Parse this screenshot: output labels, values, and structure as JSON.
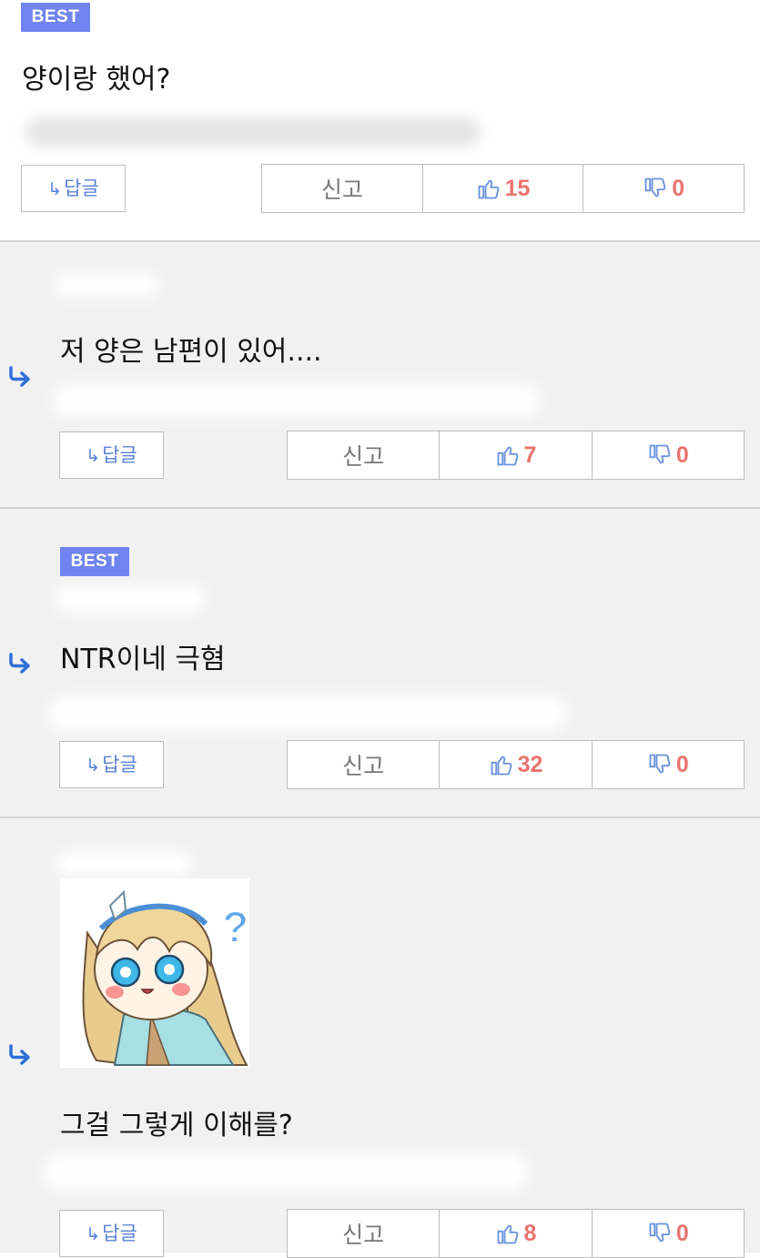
{
  "comments": [
    {
      "best": "BEST",
      "text": "양이랑 했어?",
      "reply_label": "답글",
      "report_label": "신고",
      "likes": "15",
      "dislikes": "0"
    },
    {
      "text": "저 양은 남편이 있어....",
      "reply_label": "답글",
      "report_label": "신고",
      "likes": "7",
      "dislikes": "0"
    },
    {
      "best": "BEST",
      "text": "NTR이네 극혐",
      "reply_label": "답글",
      "report_label": "신고",
      "likes": "32",
      "dislikes": "0"
    },
    {
      "text": "그걸 그렇게 이해를?",
      "reply_label": "답글",
      "report_label": "신고",
      "likes": "8",
      "dislikes": "0"
    }
  ],
  "colors": {
    "best_badge": "#6f84ef",
    "count": "#e9736f",
    "reply_text": "#5b82d6",
    "reply_arrow": "#2f6fd8",
    "reply_bg": "#f0f1f0"
  },
  "icons": [
    "reply-arrow-icon",
    "thumbs-up-icon",
    "thumbs-down-icon",
    "anime-girl-question-emoticon"
  ]
}
